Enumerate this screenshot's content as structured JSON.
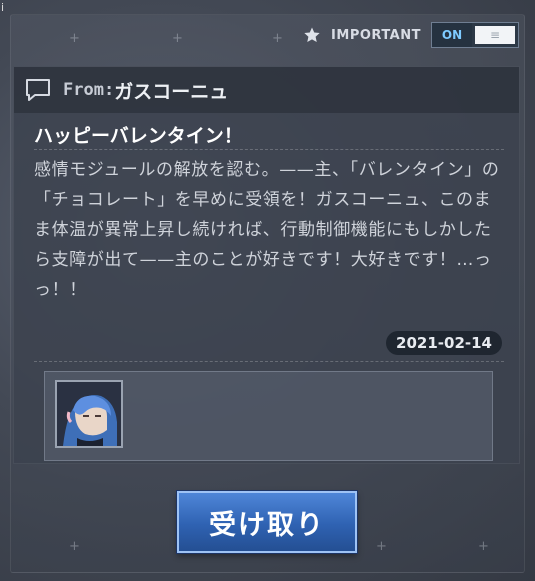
{
  "topbar": {
    "important_label": "IMPORTANT",
    "toggle_on_label": "ON",
    "toggle_knob_symbol": "≡",
    "star_icon": "star-icon",
    "accent_color": "#7ecbff"
  },
  "mail": {
    "from_prefix": "From:",
    "sender": "ガスコーニュ",
    "subject": "ハッピーバレンタイン！",
    "body": "感情モジュールの解放を認む。——主、「バレンタイン」の「チョコレート」を早めに受領を！ガスコーニュ、このまま体温が異常上昇し続ければ、行動制御機能にもしかしたら支障が出て——主のことが好きです！大好きです！…っっ！！",
    "date": "2021-02-14",
    "chat_icon": "chat-bubble-icon"
  },
  "attachment": {
    "item_icon": "character-portrait-icon"
  },
  "actions": {
    "receive_label": "受け取り",
    "button_color": "#2f62b2"
  },
  "corner": {
    "info_glyph": "i"
  }
}
